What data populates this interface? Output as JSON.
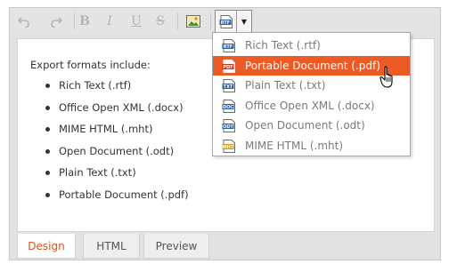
{
  "toolbar": {
    "buttons": [
      {
        "name": "undo-icon",
        "glyph": "↶"
      },
      {
        "name": "redo-icon",
        "glyph": "↷"
      },
      {
        "name": "bold-button",
        "glyph": "B"
      },
      {
        "name": "italic-button",
        "glyph": "I"
      },
      {
        "name": "underline-button",
        "glyph": "U"
      },
      {
        "name": "strikethrough-button",
        "glyph": "S"
      },
      {
        "name": "insert-image-icon",
        "glyph": ""
      },
      {
        "name": "export-rtf-icon",
        "glyph": ""
      }
    ],
    "export_icon_label": "RTF"
  },
  "content": {
    "intro": "Export formats include:",
    "formats": [
      "Rich Text (.rtf)",
      "Office Open XML (.docx)",
      "MIME HTML (.mht)",
      "Open Document (.odt)",
      "Plain Text (.txt)",
      "Portable Document (.pdf)"
    ]
  },
  "tabs": [
    "Design",
    "HTML",
    "Preview"
  ],
  "active_tab": "Design",
  "dropdown": {
    "items": [
      {
        "label": "Rich Text (.rtf)",
        "icon": "RTF",
        "color": "#2a5ea8"
      },
      {
        "label": "Portable Document (.pdf)",
        "icon": "PDF",
        "color": "#c23a2b",
        "active": true
      },
      {
        "label": "Plain Text (.txt)",
        "icon": "TXT",
        "color": "#3c5f8f"
      },
      {
        "label": "Office Open XML (.docx)",
        "icon": "DOC",
        "color": "#2a5ea8"
      },
      {
        "label": "Open Document (.odt)",
        "icon": "ODT",
        "color": "#2a5ea8"
      },
      {
        "label": "MIME HTML (.mht)",
        "icon": "MHT",
        "color": "#d49a1a"
      }
    ]
  },
  "colors": {
    "accent": "#ec5a25",
    "tab_active_text": "#d8501f",
    "toolbar_bg": "#e4e4e4"
  }
}
